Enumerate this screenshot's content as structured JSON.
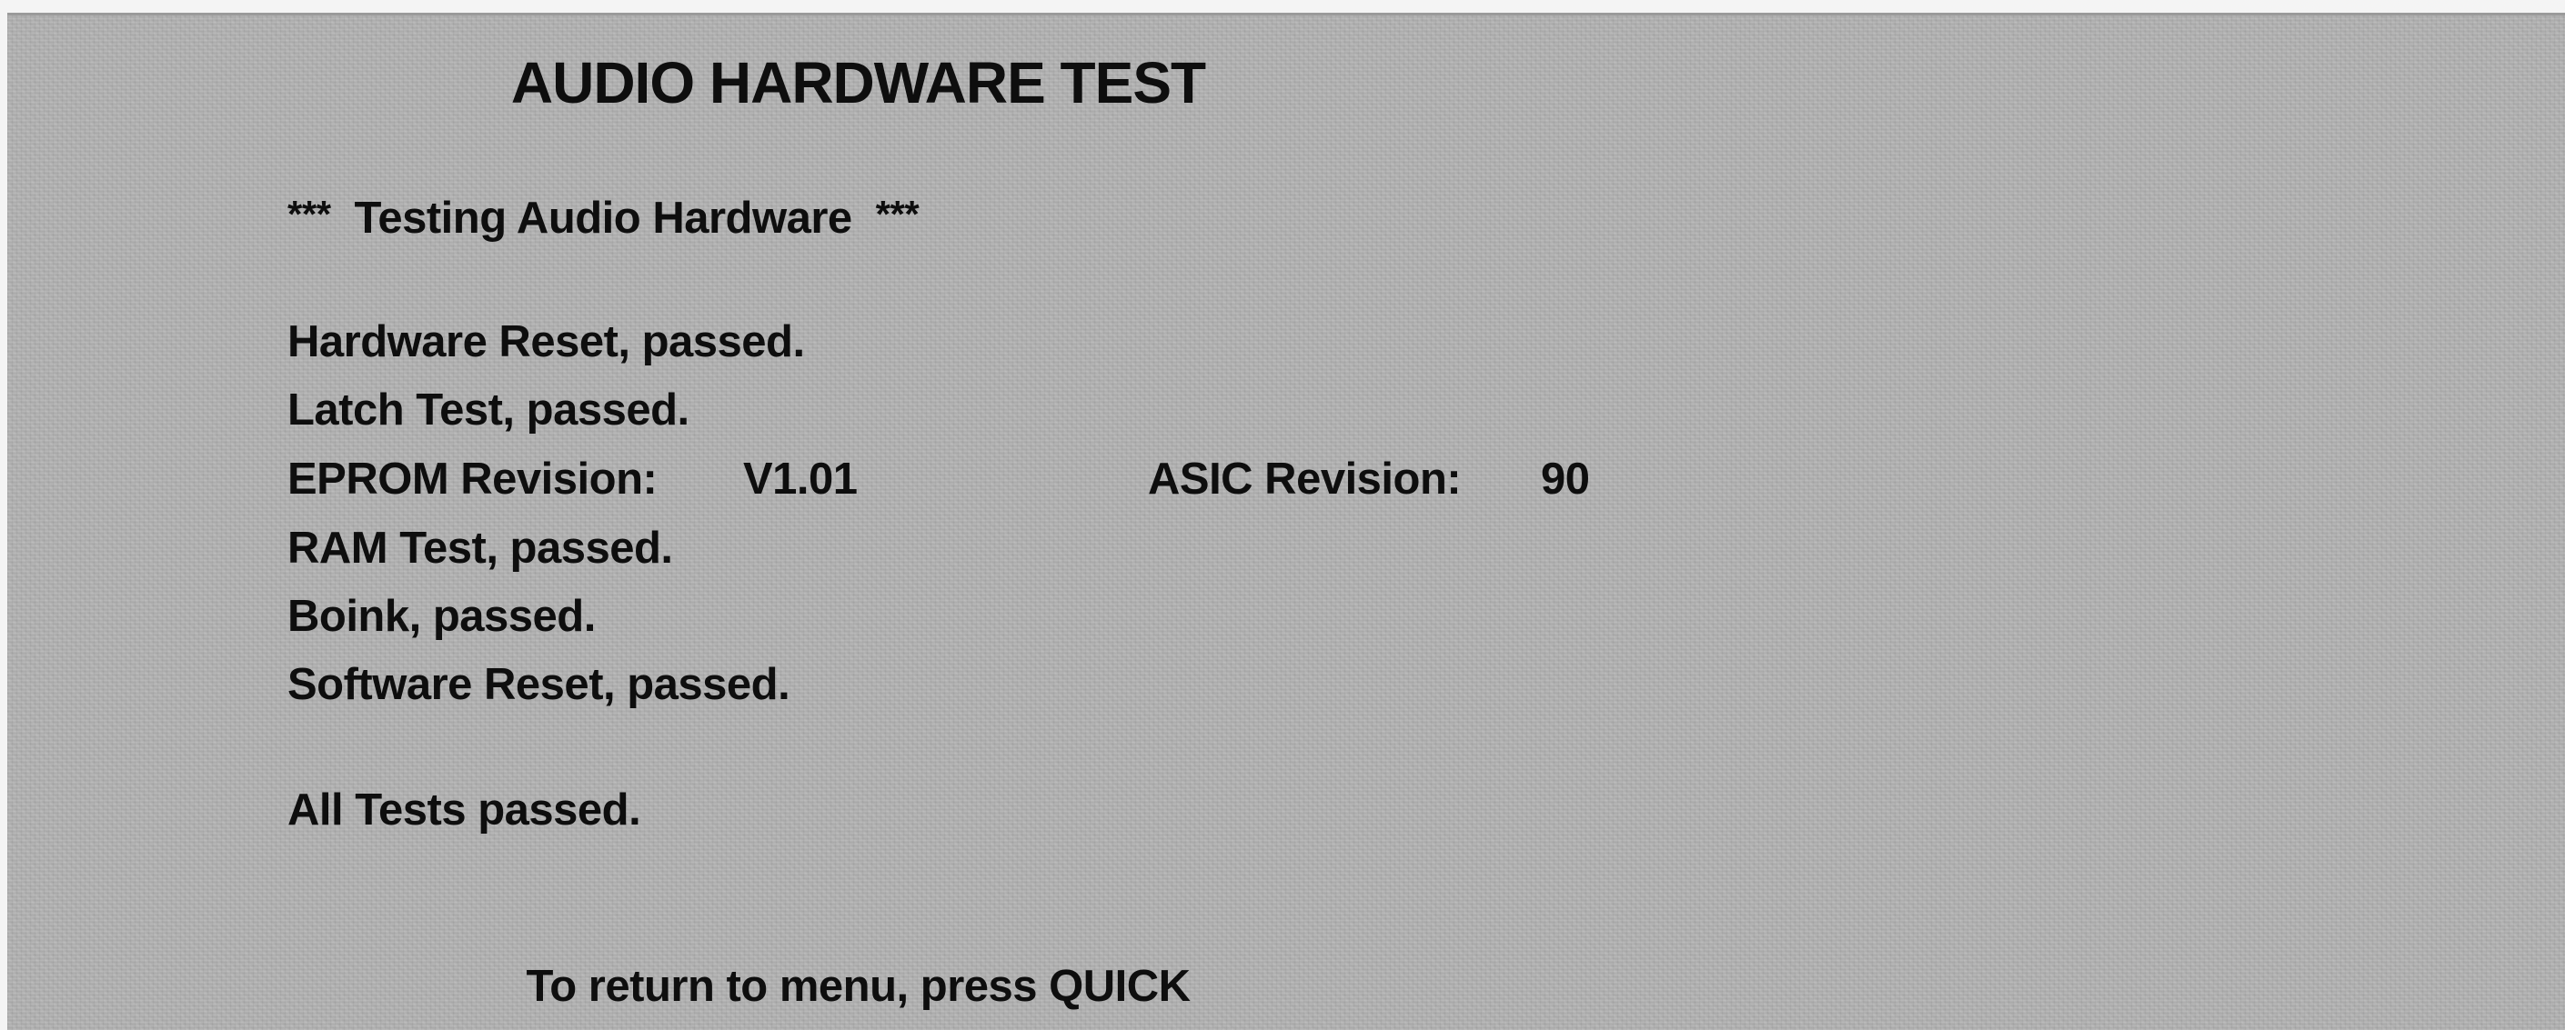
{
  "screen": {
    "title": "AUDIO HARDWARE TEST",
    "banner": {
      "stars_left": "***",
      "text": "Testing Audio Hardware",
      "stars_right": "***"
    },
    "results": [
      "Hardware Reset, passed.",
      "Latch Test, passed."
    ],
    "revisions": {
      "eprom_label": "EPROM Revision:",
      "eprom_value": "V1.01",
      "asic_label": "ASIC Revision:",
      "asic_value": "90"
    },
    "results_after": [
      "RAM Test, passed.",
      "Boink, passed.",
      "Software Reset, passed."
    ],
    "summary": "All Tests passed.",
    "footer": "To return to menu, press QUICK"
  }
}
